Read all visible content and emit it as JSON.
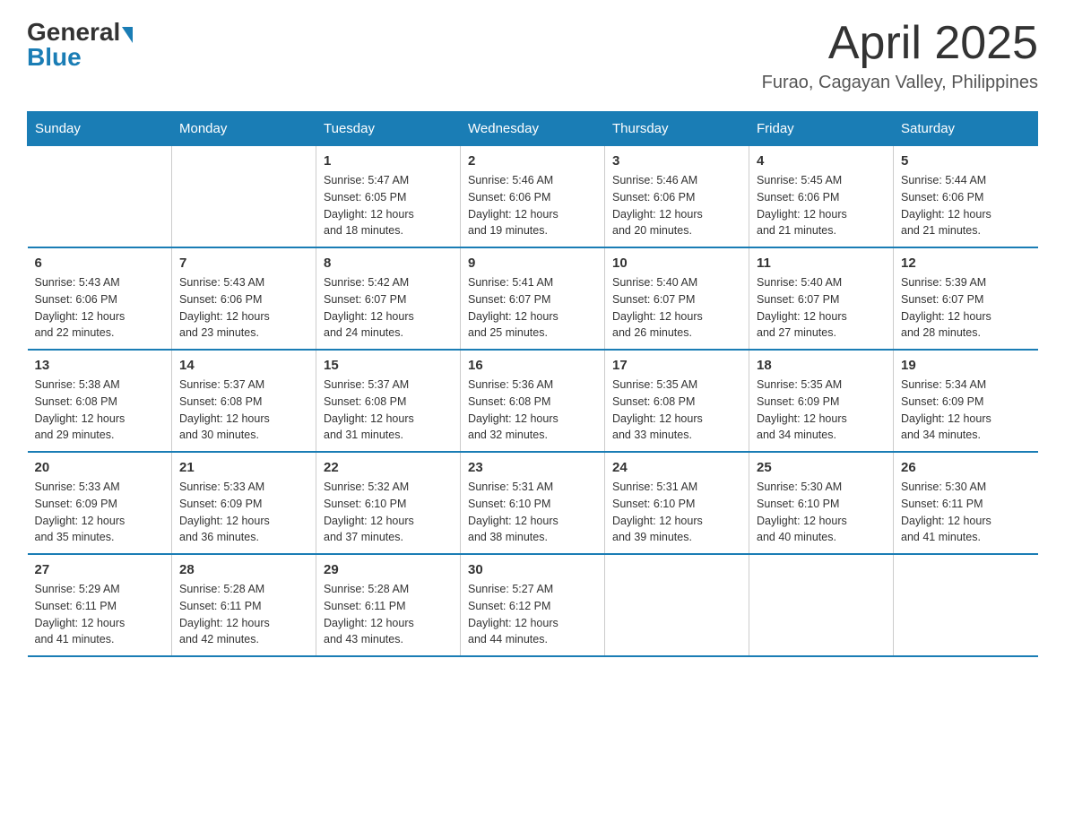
{
  "header": {
    "logo_general": "General",
    "logo_blue": "Blue",
    "month_year": "April 2025",
    "location": "Furao, Cagayan Valley, Philippines"
  },
  "days_of_week": [
    "Sunday",
    "Monday",
    "Tuesday",
    "Wednesday",
    "Thursday",
    "Friday",
    "Saturday"
  ],
  "weeks": [
    [
      {
        "day": "",
        "info": ""
      },
      {
        "day": "",
        "info": ""
      },
      {
        "day": "1",
        "info": "Sunrise: 5:47 AM\nSunset: 6:05 PM\nDaylight: 12 hours\nand 18 minutes."
      },
      {
        "day": "2",
        "info": "Sunrise: 5:46 AM\nSunset: 6:06 PM\nDaylight: 12 hours\nand 19 minutes."
      },
      {
        "day": "3",
        "info": "Sunrise: 5:46 AM\nSunset: 6:06 PM\nDaylight: 12 hours\nand 20 minutes."
      },
      {
        "day": "4",
        "info": "Sunrise: 5:45 AM\nSunset: 6:06 PM\nDaylight: 12 hours\nand 21 minutes."
      },
      {
        "day": "5",
        "info": "Sunrise: 5:44 AM\nSunset: 6:06 PM\nDaylight: 12 hours\nand 21 minutes."
      }
    ],
    [
      {
        "day": "6",
        "info": "Sunrise: 5:43 AM\nSunset: 6:06 PM\nDaylight: 12 hours\nand 22 minutes."
      },
      {
        "day": "7",
        "info": "Sunrise: 5:43 AM\nSunset: 6:06 PM\nDaylight: 12 hours\nand 23 minutes."
      },
      {
        "day": "8",
        "info": "Sunrise: 5:42 AM\nSunset: 6:07 PM\nDaylight: 12 hours\nand 24 minutes."
      },
      {
        "day": "9",
        "info": "Sunrise: 5:41 AM\nSunset: 6:07 PM\nDaylight: 12 hours\nand 25 minutes."
      },
      {
        "day": "10",
        "info": "Sunrise: 5:40 AM\nSunset: 6:07 PM\nDaylight: 12 hours\nand 26 minutes."
      },
      {
        "day": "11",
        "info": "Sunrise: 5:40 AM\nSunset: 6:07 PM\nDaylight: 12 hours\nand 27 minutes."
      },
      {
        "day": "12",
        "info": "Sunrise: 5:39 AM\nSunset: 6:07 PM\nDaylight: 12 hours\nand 28 minutes."
      }
    ],
    [
      {
        "day": "13",
        "info": "Sunrise: 5:38 AM\nSunset: 6:08 PM\nDaylight: 12 hours\nand 29 minutes."
      },
      {
        "day": "14",
        "info": "Sunrise: 5:37 AM\nSunset: 6:08 PM\nDaylight: 12 hours\nand 30 minutes."
      },
      {
        "day": "15",
        "info": "Sunrise: 5:37 AM\nSunset: 6:08 PM\nDaylight: 12 hours\nand 31 minutes."
      },
      {
        "day": "16",
        "info": "Sunrise: 5:36 AM\nSunset: 6:08 PM\nDaylight: 12 hours\nand 32 minutes."
      },
      {
        "day": "17",
        "info": "Sunrise: 5:35 AM\nSunset: 6:08 PM\nDaylight: 12 hours\nand 33 minutes."
      },
      {
        "day": "18",
        "info": "Sunrise: 5:35 AM\nSunset: 6:09 PM\nDaylight: 12 hours\nand 34 minutes."
      },
      {
        "day": "19",
        "info": "Sunrise: 5:34 AM\nSunset: 6:09 PM\nDaylight: 12 hours\nand 34 minutes."
      }
    ],
    [
      {
        "day": "20",
        "info": "Sunrise: 5:33 AM\nSunset: 6:09 PM\nDaylight: 12 hours\nand 35 minutes."
      },
      {
        "day": "21",
        "info": "Sunrise: 5:33 AM\nSunset: 6:09 PM\nDaylight: 12 hours\nand 36 minutes."
      },
      {
        "day": "22",
        "info": "Sunrise: 5:32 AM\nSunset: 6:10 PM\nDaylight: 12 hours\nand 37 minutes."
      },
      {
        "day": "23",
        "info": "Sunrise: 5:31 AM\nSunset: 6:10 PM\nDaylight: 12 hours\nand 38 minutes."
      },
      {
        "day": "24",
        "info": "Sunrise: 5:31 AM\nSunset: 6:10 PM\nDaylight: 12 hours\nand 39 minutes."
      },
      {
        "day": "25",
        "info": "Sunrise: 5:30 AM\nSunset: 6:10 PM\nDaylight: 12 hours\nand 40 minutes."
      },
      {
        "day": "26",
        "info": "Sunrise: 5:30 AM\nSunset: 6:11 PM\nDaylight: 12 hours\nand 41 minutes."
      }
    ],
    [
      {
        "day": "27",
        "info": "Sunrise: 5:29 AM\nSunset: 6:11 PM\nDaylight: 12 hours\nand 41 minutes."
      },
      {
        "day": "28",
        "info": "Sunrise: 5:28 AM\nSunset: 6:11 PM\nDaylight: 12 hours\nand 42 minutes."
      },
      {
        "day": "29",
        "info": "Sunrise: 5:28 AM\nSunset: 6:11 PM\nDaylight: 12 hours\nand 43 minutes."
      },
      {
        "day": "30",
        "info": "Sunrise: 5:27 AM\nSunset: 6:12 PM\nDaylight: 12 hours\nand 44 minutes."
      },
      {
        "day": "",
        "info": ""
      },
      {
        "day": "",
        "info": ""
      },
      {
        "day": "",
        "info": ""
      }
    ]
  ]
}
